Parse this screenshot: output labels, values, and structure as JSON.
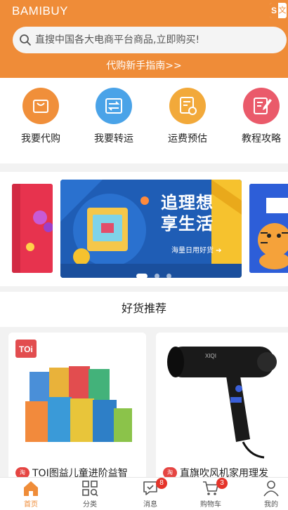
{
  "header": {
    "brand": "BAMIBUY",
    "lang_icon": "language-switch-icon",
    "search_placeholder": "直搜中国各大电商平台商品,立即购买!",
    "guide_link": "代购新手指南>>"
  },
  "actions": [
    {
      "label": "我要代购",
      "icon": "shopping-bag-icon",
      "color": "#f08f3a"
    },
    {
      "label": "我要转运",
      "icon": "transfer-icon",
      "color": "#4aa3e8"
    },
    {
      "label": "运费预估",
      "icon": "calculator-icon",
      "color": "#f2a93a"
    },
    {
      "label": "教程攻略",
      "icon": "guide-icon",
      "color": "#ea5a6a"
    }
  ],
  "banner": {
    "title_line1": "追理想",
    "title_line2": "享生活",
    "subtitle": "海量日用好货",
    "active_dot": 0
  },
  "section": {
    "title": "好货推荐"
  },
  "products": [
    {
      "title": "TOI图益儿童进阶益智",
      "tag": "淘",
      "brand_label": "TOi"
    },
    {
      "title": "直旗吹风机家用理发",
      "tag": "淘",
      "brand_label": "XIQI"
    }
  ],
  "nav": [
    {
      "label": "首页",
      "icon": "home-icon",
      "active": true
    },
    {
      "label": "分类",
      "icon": "category-icon"
    },
    {
      "label": "消息",
      "icon": "message-icon",
      "badge": "8"
    },
    {
      "label": "购物车",
      "icon": "cart-icon",
      "badge": "3"
    },
    {
      "label": "我的",
      "icon": "profile-icon"
    }
  ],
  "colors": {
    "accent": "#ef8c38",
    "badge": "#e5342a"
  }
}
